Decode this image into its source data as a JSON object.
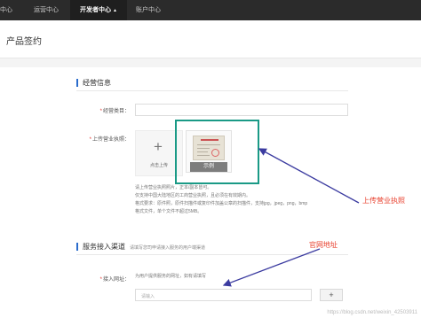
{
  "nav": {
    "items": [
      {
        "label": "中心"
      },
      {
        "label": "运营中心"
      },
      {
        "label": "开发者中心"
      },
      {
        "label": "账户中心"
      }
    ],
    "caret": "▲"
  },
  "page": {
    "title": "产品签约"
  },
  "business_section": {
    "title": "经营信息",
    "category_label": "经营类目：",
    "license_label": "上传营业执照：",
    "upload_plus": "+",
    "upload_text": "点击上传",
    "sample_label": "示例",
    "hints": [
      "请上传营业执照照片，正本/副本皆可。",
      "仅支持中国大陆地区的工商营业执照，且必须在有效期内。",
      "格式要求：原件照，原件扫描件或复印件加盖公章的扫描件，支持jpg，jpeg，png，bmp",
      "格式文件，单个文件不超过5MB。"
    ]
  },
  "access_section": {
    "title": "服务接入渠道",
    "subtitle": "请填写您司申请接入服务的用户端渠道",
    "url_label": "接入网址：",
    "url_hint": "为用户提供服务的网址，如有请填写",
    "input_placeholder": "请输入",
    "add_button": "+"
  },
  "annotations": {
    "license": "上传营业执照",
    "website": "官网地址",
    "color": "#e8402e"
  },
  "accent_color": "#2a6ccc",
  "highlight_color": "#1a9a86",
  "watermark": "https://blog.csdn.net/weixin_42503911"
}
